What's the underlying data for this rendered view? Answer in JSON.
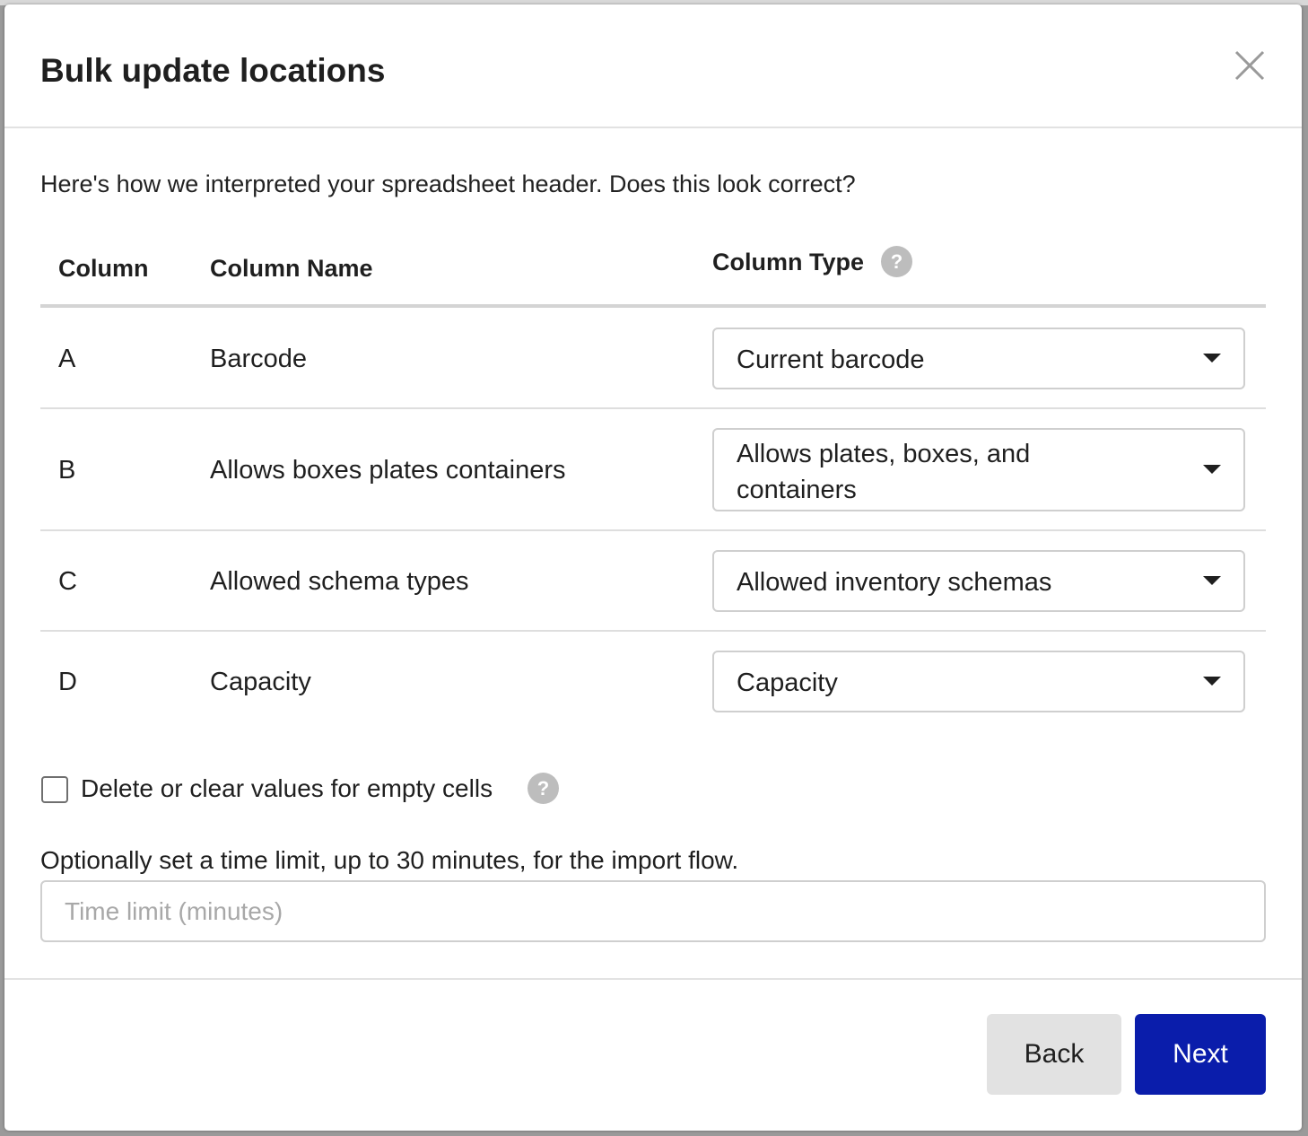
{
  "dialog": {
    "title": "Bulk update locations",
    "close_icon": "close-icon",
    "intro": "Here's how we interpreted your spreadsheet header. Does this look correct?"
  },
  "table": {
    "headers": {
      "column": "Column",
      "column_name": "Column Name",
      "column_type": "Column Type",
      "help_glyph": "?"
    },
    "rows": [
      {
        "column": "A",
        "name": "Barcode",
        "type": "Current barcode"
      },
      {
        "column": "B",
        "name": "Allows boxes plates containers",
        "type": "Allows plates, boxes, and containers"
      },
      {
        "column": "C",
        "name": "Allowed schema types",
        "type": "Allowed inventory schemas"
      },
      {
        "column": "D",
        "name": "Capacity",
        "type": "Capacity"
      }
    ]
  },
  "options": {
    "empty_cells_label": "Delete or clear values for empty cells",
    "empty_cells_checked": false,
    "help_glyph": "?",
    "time_limit_label": "Optionally set a time limit, up to 30 minutes, for the import flow.",
    "time_limit_value": "",
    "time_limit_placeholder": "Time limit (minutes)"
  },
  "footer": {
    "back_label": "Back",
    "next_label": "Next"
  },
  "colors": {
    "primary": "#0a1dab",
    "secondary_button": "#e2e2e2",
    "help_icon": "#bdbdbd"
  }
}
